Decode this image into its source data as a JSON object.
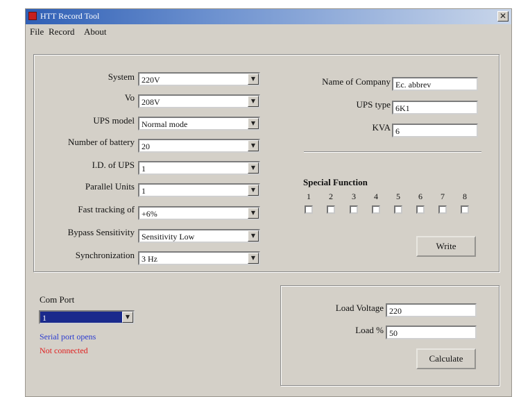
{
  "window": {
    "title": "HTT Record Tool",
    "close_glyph": "✕"
  },
  "menu": [
    "File",
    "Record",
    "About"
  ],
  "config": {
    "fields": [
      {
        "label": "System",
        "value": "220V"
      },
      {
        "label": "Vo",
        "value": "208V"
      },
      {
        "label": "UPS model",
        "value": "Normal mode"
      },
      {
        "label": "Number of battery",
        "value": "20"
      },
      {
        "label": "I.D. of UPS",
        "value": "1"
      },
      {
        "label": "Parallel Units",
        "value": "1"
      },
      {
        "label": "Fast tracking of",
        "value": "+6%"
      },
      {
        "label": "Bypass Sensitivity",
        "value": "Sensitivity Low"
      },
      {
        "label": "Synchronization",
        "value": "3 Hz"
      }
    ]
  },
  "company": {
    "name_label": "Name of Company",
    "name_value": "Ec. abbrev",
    "ups_type_label": "UPS type",
    "ups_type_value": "6K1",
    "kva_label": "KVA",
    "kva_value": "6"
  },
  "special": {
    "title": "Special Function",
    "numbers": [
      "1",
      "2",
      "3",
      "4",
      "5",
      "6",
      "7",
      "8"
    ],
    "write_label": "Write"
  },
  "com": {
    "label": "Com Port",
    "value": "1",
    "status1": "Serial port opens",
    "status1_color": "#2a3ad0",
    "status2": "Not connected",
    "status2_color": "#e02020",
    "combo_color": "#1a2a8c"
  },
  "calc": {
    "load_voltage_label": "Load Voltage",
    "load_voltage_value": "220",
    "load_pct_label": "Load %",
    "load_pct_value": "50",
    "calculate_label": "Calculate"
  }
}
